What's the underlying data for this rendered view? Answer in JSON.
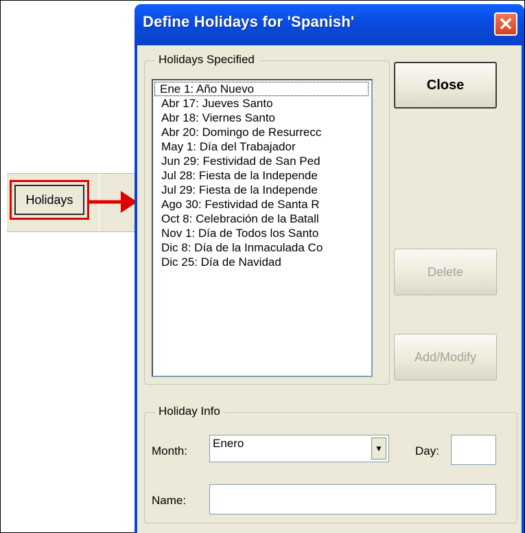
{
  "toolbar": {
    "holidays_label": "Holidays"
  },
  "dialog": {
    "title": "Define Holidays for 'Spanish'",
    "close_glyph": "✕",
    "holidays_group_label": "Holidays Specified",
    "holidays": [
      "Ene 1: Año Nuevo",
      "Abr 17: Jueves Santo",
      "Abr 18: Viernes Santo",
      "Abr 20: Domingo de Resurrecc",
      "May 1: Día del Trabajador",
      "Jun 29: Festividad de San Ped",
      "Jul 28: Fiesta de la Independe",
      "Jul 29: Fiesta de la Independe",
      "Ago 30: Festividad de Santa R",
      "Oct 8: Celebración de la Batall",
      "Nov 1: Día de Todos los Santo",
      "Dic 8: Día de la Inmaculada Co",
      "Dic 25: Día de Navidad"
    ],
    "close_button": "Close",
    "delete_button": "Delete",
    "addmodify_button": "Add/Modify",
    "info_group_label": "Holiday Info",
    "month_label": "Month:",
    "month_value": "Enero",
    "day_label": "Day:",
    "day_value": "",
    "name_label": "Name:",
    "name_value": ""
  },
  "colors": {
    "title_blue": "#0a46d6",
    "highlight_red": "#e00000",
    "face": "#ece9d8"
  }
}
